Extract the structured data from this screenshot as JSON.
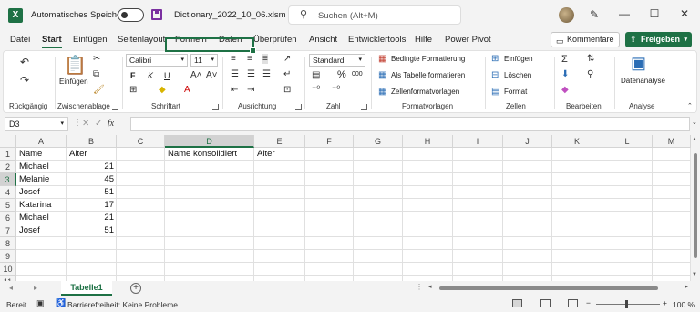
{
  "titlebar": {
    "app_icon": "X",
    "autosave_label": "Automatisches Speichern",
    "autosave_state": "off",
    "filename": "Dictionary_2022_10_06.xlsm",
    "search_placeholder": "Suchen (Alt+M)"
  },
  "menu": {
    "items": [
      "Datei",
      "Start",
      "Einfügen",
      "Seitenlayout",
      "Formeln",
      "Daten",
      "Überprüfen",
      "Ansicht",
      "Entwicklertools",
      "Hilfe",
      "Power Pivot"
    ],
    "active": "Start",
    "comments_label": "Kommentare",
    "share_label": "Freigeben"
  },
  "ribbon": {
    "groups": [
      "Rückgängig",
      "Zwischenablage",
      "Schriftart",
      "Ausrichtung",
      "Zahl",
      "Formatvorlagen",
      "Zellen",
      "Bearbeiten",
      "Analyse"
    ],
    "paste_label": "Einfügen",
    "font_name": "Calibri",
    "font_size": "11",
    "number_format": "Standard",
    "cond_format": "Bedingte Formatierung",
    "format_table": "Als Tabelle formatieren",
    "cell_styles": "Zellenformatvorlagen",
    "insert": "Einfügen",
    "delete": "Löschen",
    "format": "Format",
    "data_analysis": "Datenanalyse",
    "bold": "F",
    "italic": "K",
    "underline": "U",
    "percent": "%",
    "thousands": "000"
  },
  "formula": {
    "name_box": "D3",
    "fx": "fx",
    "content": ""
  },
  "grid": {
    "columns": [
      "A",
      "B",
      "C",
      "D",
      "E",
      "F",
      "G",
      "H",
      "I",
      "J",
      "K",
      "L",
      "M"
    ],
    "rows": [
      "1",
      "2",
      "3",
      "4",
      "5",
      "6",
      "7",
      "8",
      "9",
      "10",
      "11"
    ],
    "selected_column": "D",
    "selected_row": "3",
    "cells": {
      "A1": "Name",
      "B1": "Alter",
      "D1": "Name konsolidiert",
      "E1": "Alter",
      "A2": "Michael",
      "B2": "21",
      "A3": "Melanie",
      "B3": "45",
      "A4": "Josef",
      "B4": "51",
      "A5": "Katarina",
      "B5": "17",
      "A6": "Michael",
      "B6": "21",
      "A7": "Josef",
      "B7": "51"
    }
  },
  "sheets": {
    "tabs": [
      "Tabelle1"
    ],
    "active": "Tabelle1"
  },
  "status": {
    "ready": "Bereit",
    "accessibility": "Barrierefreiheit: Keine Probleme",
    "zoom": "100 %"
  },
  "colors": {
    "accent": "#1e7145",
    "save_icon": "#7a2fa0"
  }
}
